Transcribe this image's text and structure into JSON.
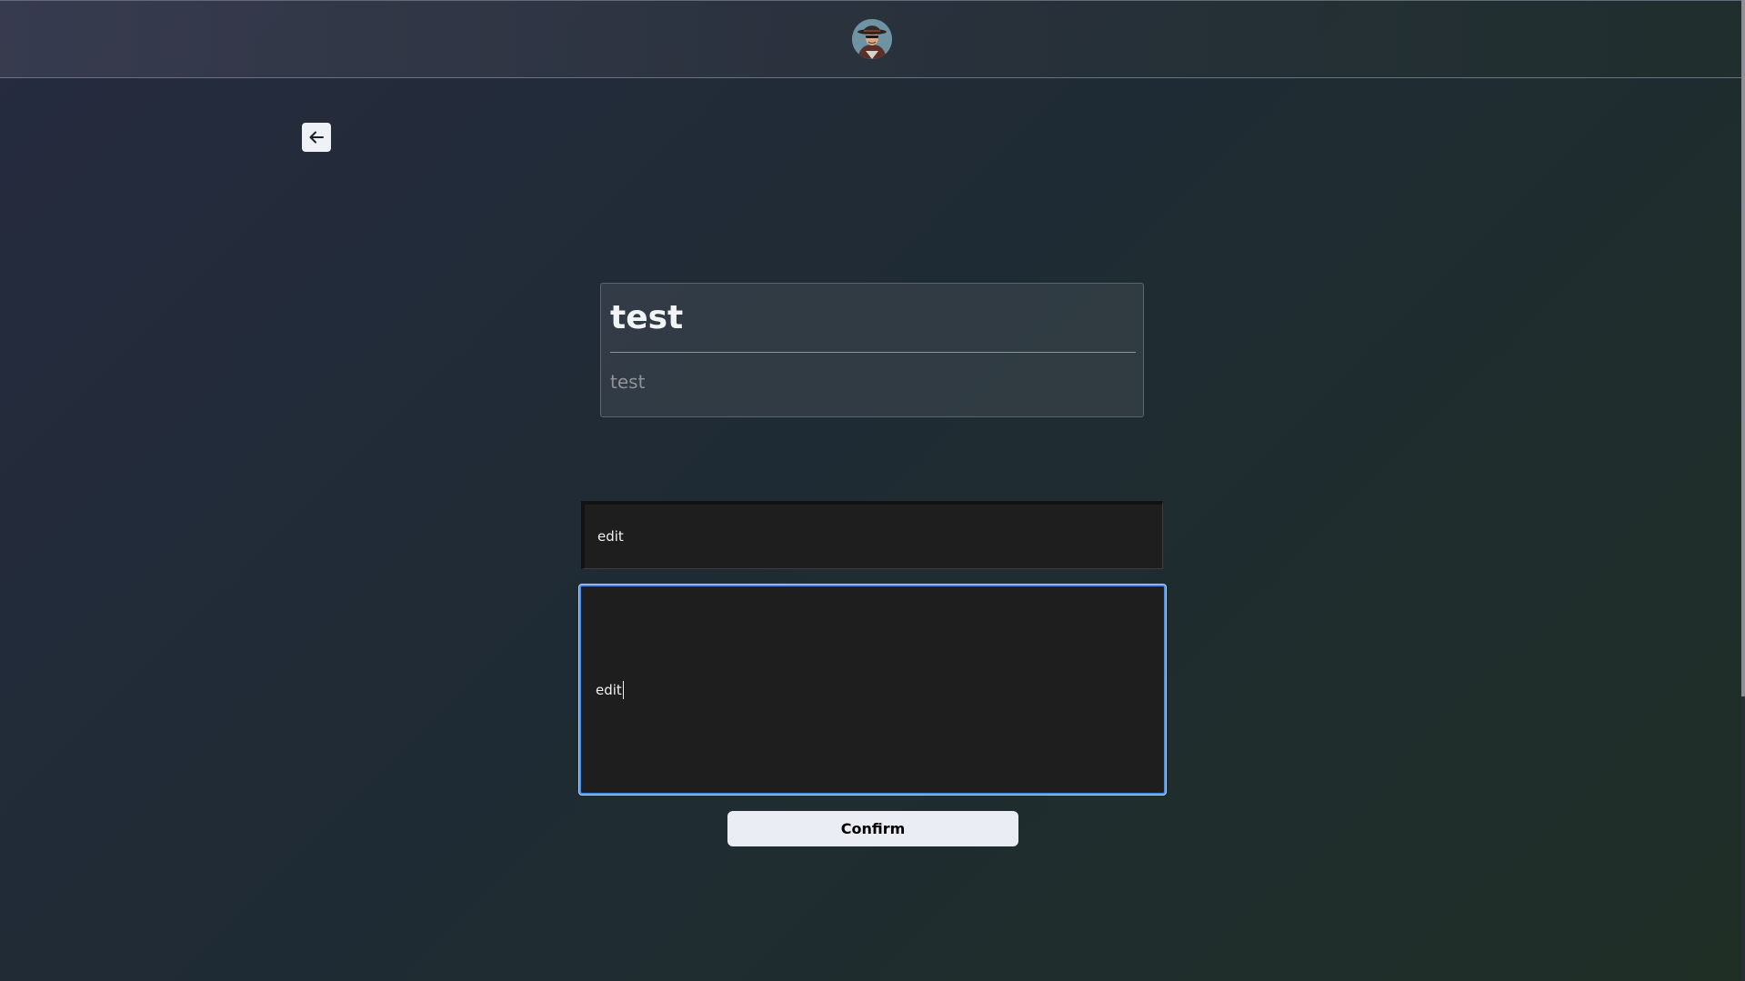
{
  "header": {
    "avatar_icon": "user-avatar"
  },
  "nav": {
    "back_icon": "arrow-left-icon"
  },
  "card": {
    "title": "test",
    "description": "test"
  },
  "form": {
    "title_value": "edit",
    "description_value": "edit",
    "confirm_label": "Confirm"
  },
  "colors": {
    "focus_ring": "#4a8fe8",
    "button_bg": "#eaedf4",
    "input_bg": "#1e1e1e"
  }
}
